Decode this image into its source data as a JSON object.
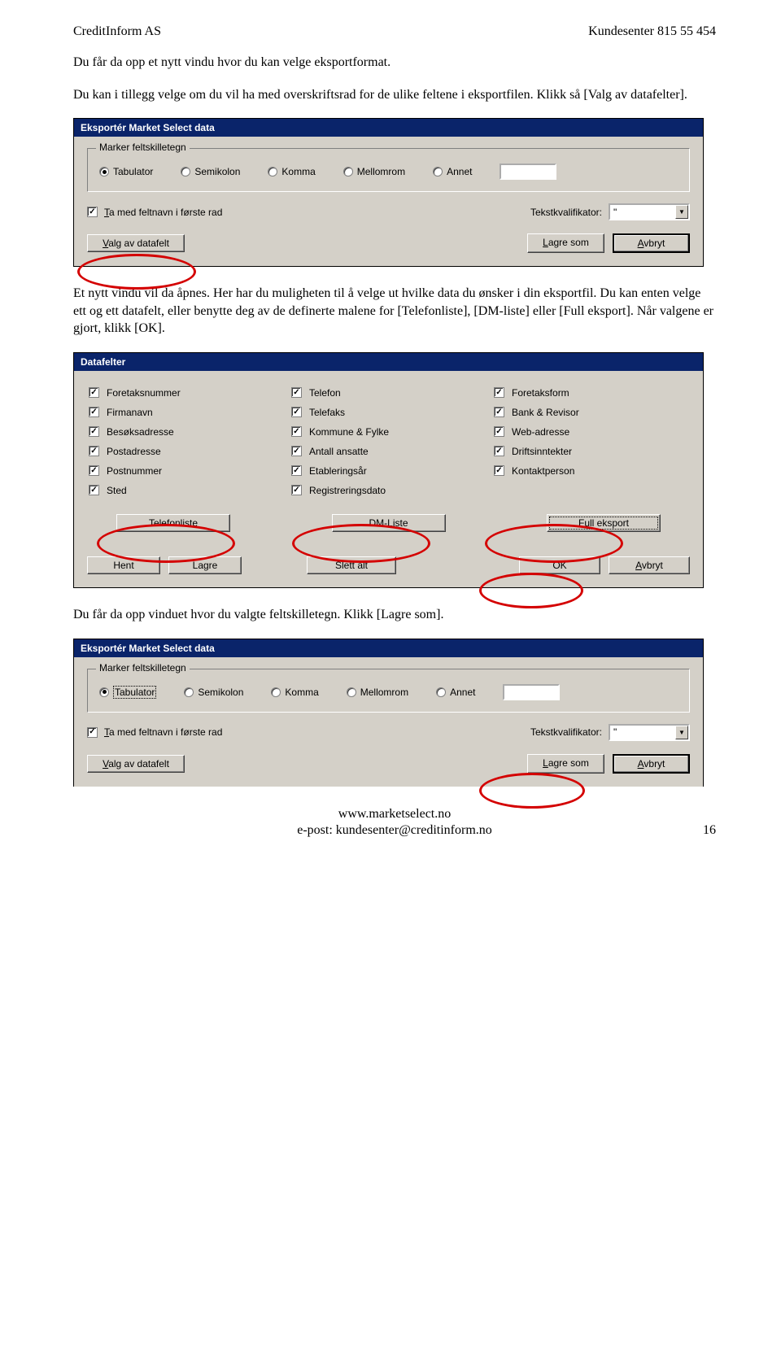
{
  "header": {
    "left": "CreditInform AS",
    "right": "Kundesenter 815 55 454"
  },
  "para1": "Du får da opp et nytt vindu hvor du kan velge eksportformat.",
  "para2": "Du kan i tillegg velge om du vil ha med overskriftsrad for de ulike feltene i eksportfilen. Klikk så [Valg av datafelter].",
  "para3": "Et nytt vindu vil da åpnes. Her har du muligheten til å velge ut hvilke data du ønsker i din eksportfil. Du kan enten velge ett og ett datafelt, eller benytte deg av de definerte malene for [Telefonliste], [DM-liste] eller [Full eksport]. Når valgene er gjort, klikk [OK].",
  "para4": "Du får da opp vinduet hvor du valgte feltskilletegn. Klikk [Lagre som].",
  "export_dialog": {
    "title": "Eksportér Market Select data",
    "group_label": "Marker feltskilletegn",
    "radios": {
      "tab": "Tabulator",
      "semi": "Semikolon",
      "komma": "Komma",
      "mellom": "Mellomrom",
      "annet": "Annet"
    },
    "include_first": "Ta med feltnavn i første rad",
    "tekstkval_label": "Tekstkvalifikator:",
    "tekstkval_value": "\"",
    "btn_valg": "Valg av datafelt",
    "btn_lagre": "Lagre som",
    "btn_avbryt": "Avbryt"
  },
  "datafelter": {
    "title": "Datafelter",
    "fields": [
      [
        "Foretaksnummer",
        "Telefon",
        "Foretaksform"
      ],
      [
        "Firmanavn",
        "Telefaks",
        "Bank & Revisor"
      ],
      [
        "Besøksadresse",
        "Kommune & Fylke",
        "Web-adresse"
      ],
      [
        "Postadresse",
        "Antall ansatte",
        "Driftsinntekter"
      ],
      [
        "Postnummer",
        "Etableringsår",
        "Kontaktperson"
      ],
      [
        "Sted",
        "Registreringsdato",
        ""
      ]
    ],
    "btn_telefon": "Telefonliste",
    "btn_dm": "DM-Liste",
    "btn_full": "Full eksport",
    "btn_hent": "Hent",
    "btn_lagre": "Lagre",
    "btn_slett": "Slett alt",
    "btn_ok": "OK",
    "btn_avbryt": "Avbryt"
  },
  "footer": {
    "line1": "www.marketselect.no",
    "line2": "e-post: kundesenter@creditinform.no",
    "page": "16"
  }
}
